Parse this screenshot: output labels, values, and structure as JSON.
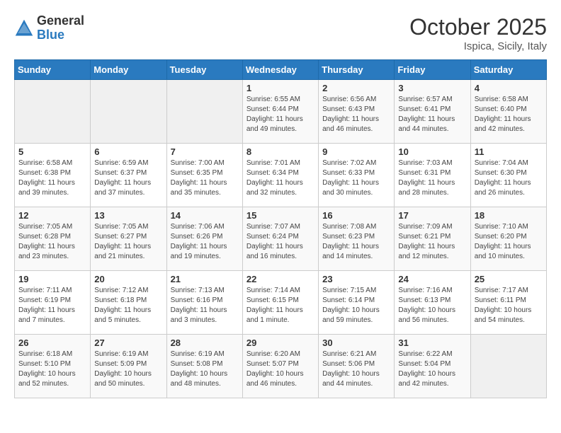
{
  "header": {
    "logo_general": "General",
    "logo_blue": "Blue",
    "month": "October 2025",
    "location": "Ispica, Sicily, Italy"
  },
  "days_of_week": [
    "Sunday",
    "Monday",
    "Tuesday",
    "Wednesday",
    "Thursday",
    "Friday",
    "Saturday"
  ],
  "weeks": [
    [
      {
        "day": "",
        "info": ""
      },
      {
        "day": "",
        "info": ""
      },
      {
        "day": "",
        "info": ""
      },
      {
        "day": "1",
        "info": "Sunrise: 6:55 AM\nSunset: 6:44 PM\nDaylight: 11 hours\nand 49 minutes."
      },
      {
        "day": "2",
        "info": "Sunrise: 6:56 AM\nSunset: 6:43 PM\nDaylight: 11 hours\nand 46 minutes."
      },
      {
        "day": "3",
        "info": "Sunrise: 6:57 AM\nSunset: 6:41 PM\nDaylight: 11 hours\nand 44 minutes."
      },
      {
        "day": "4",
        "info": "Sunrise: 6:58 AM\nSunset: 6:40 PM\nDaylight: 11 hours\nand 42 minutes."
      }
    ],
    [
      {
        "day": "5",
        "info": "Sunrise: 6:58 AM\nSunset: 6:38 PM\nDaylight: 11 hours\nand 39 minutes."
      },
      {
        "day": "6",
        "info": "Sunrise: 6:59 AM\nSunset: 6:37 PM\nDaylight: 11 hours\nand 37 minutes."
      },
      {
        "day": "7",
        "info": "Sunrise: 7:00 AM\nSunset: 6:35 PM\nDaylight: 11 hours\nand 35 minutes."
      },
      {
        "day": "8",
        "info": "Sunrise: 7:01 AM\nSunset: 6:34 PM\nDaylight: 11 hours\nand 32 minutes."
      },
      {
        "day": "9",
        "info": "Sunrise: 7:02 AM\nSunset: 6:33 PM\nDaylight: 11 hours\nand 30 minutes."
      },
      {
        "day": "10",
        "info": "Sunrise: 7:03 AM\nSunset: 6:31 PM\nDaylight: 11 hours\nand 28 minutes."
      },
      {
        "day": "11",
        "info": "Sunrise: 7:04 AM\nSunset: 6:30 PM\nDaylight: 11 hours\nand 26 minutes."
      }
    ],
    [
      {
        "day": "12",
        "info": "Sunrise: 7:05 AM\nSunset: 6:28 PM\nDaylight: 11 hours\nand 23 minutes."
      },
      {
        "day": "13",
        "info": "Sunrise: 7:05 AM\nSunset: 6:27 PM\nDaylight: 11 hours\nand 21 minutes."
      },
      {
        "day": "14",
        "info": "Sunrise: 7:06 AM\nSunset: 6:26 PM\nDaylight: 11 hours\nand 19 minutes."
      },
      {
        "day": "15",
        "info": "Sunrise: 7:07 AM\nSunset: 6:24 PM\nDaylight: 11 hours\nand 16 minutes."
      },
      {
        "day": "16",
        "info": "Sunrise: 7:08 AM\nSunset: 6:23 PM\nDaylight: 11 hours\nand 14 minutes."
      },
      {
        "day": "17",
        "info": "Sunrise: 7:09 AM\nSunset: 6:21 PM\nDaylight: 11 hours\nand 12 minutes."
      },
      {
        "day": "18",
        "info": "Sunrise: 7:10 AM\nSunset: 6:20 PM\nDaylight: 11 hours\nand 10 minutes."
      }
    ],
    [
      {
        "day": "19",
        "info": "Sunrise: 7:11 AM\nSunset: 6:19 PM\nDaylight: 11 hours\nand 7 minutes."
      },
      {
        "day": "20",
        "info": "Sunrise: 7:12 AM\nSunset: 6:18 PM\nDaylight: 11 hours\nand 5 minutes."
      },
      {
        "day": "21",
        "info": "Sunrise: 7:13 AM\nSunset: 6:16 PM\nDaylight: 11 hours\nand 3 minutes."
      },
      {
        "day": "22",
        "info": "Sunrise: 7:14 AM\nSunset: 6:15 PM\nDaylight: 11 hours\nand 1 minute."
      },
      {
        "day": "23",
        "info": "Sunrise: 7:15 AM\nSunset: 6:14 PM\nDaylight: 10 hours\nand 59 minutes."
      },
      {
        "day": "24",
        "info": "Sunrise: 7:16 AM\nSunset: 6:13 PM\nDaylight: 10 hours\nand 56 minutes."
      },
      {
        "day": "25",
        "info": "Sunrise: 7:17 AM\nSunset: 6:11 PM\nDaylight: 10 hours\nand 54 minutes."
      }
    ],
    [
      {
        "day": "26",
        "info": "Sunrise: 6:18 AM\nSunset: 5:10 PM\nDaylight: 10 hours\nand 52 minutes."
      },
      {
        "day": "27",
        "info": "Sunrise: 6:19 AM\nSunset: 5:09 PM\nDaylight: 10 hours\nand 50 minutes."
      },
      {
        "day": "28",
        "info": "Sunrise: 6:19 AM\nSunset: 5:08 PM\nDaylight: 10 hours\nand 48 minutes."
      },
      {
        "day": "29",
        "info": "Sunrise: 6:20 AM\nSunset: 5:07 PM\nDaylight: 10 hours\nand 46 minutes."
      },
      {
        "day": "30",
        "info": "Sunrise: 6:21 AM\nSunset: 5:06 PM\nDaylight: 10 hours\nand 44 minutes."
      },
      {
        "day": "31",
        "info": "Sunrise: 6:22 AM\nSunset: 5:04 PM\nDaylight: 10 hours\nand 42 minutes."
      },
      {
        "day": "",
        "info": ""
      }
    ]
  ]
}
